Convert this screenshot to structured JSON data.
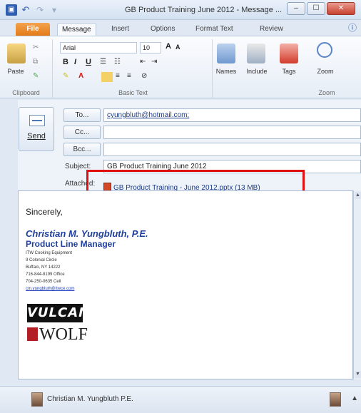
{
  "window": {
    "title": "GB Product Training June 2012 - Message ...",
    "buttons": {
      "minimize": "–",
      "maximize": "☐",
      "close": "✕"
    }
  },
  "qat": {
    "save": "▣",
    "undo": "↶",
    "redo": "↷",
    "customize": "▾"
  },
  "tabs": [
    {
      "label": "File"
    },
    {
      "label": "Message"
    },
    {
      "label": "Insert"
    },
    {
      "label": "Options"
    },
    {
      "label": "Format Text"
    },
    {
      "label": "Review"
    }
  ],
  "ribbon": {
    "clipboard": {
      "paste": "Paste",
      "group": "Clipboard"
    },
    "basic_text": {
      "font": "Arial",
      "size": "10",
      "grow": "A",
      "shrink": "A",
      "bold": "B",
      "italic": "I",
      "underline": "U",
      "group": "Basic Text"
    },
    "names": "Names",
    "include": "Include",
    "tags": "Tags",
    "zoom": {
      "button": "Zoom",
      "group": "Zoom"
    }
  },
  "compose": {
    "send": "Send",
    "to_button": "To...",
    "cc_button": "Cc...",
    "bcc_button": "Bcc...",
    "to_value": "cyungbluth@hotmail.com;",
    "cc_value": "",
    "bcc_value": "",
    "subject_label": "Subject:",
    "subject_value": "GB Product Training June 2012",
    "attached_label": "Attached:",
    "attachment": "GB Product Training - June 2012.pptx (13 MB)"
  },
  "body": {
    "greeting": "Sincerely,",
    "signature": {
      "name": "Christian M. Yungbluth, P.E.",
      "title": "Product Line Manager",
      "lines": [
        "ITW Cooking Equipment",
        "9 Colonial Circle",
        "Buffalo, NY 14222",
        "716-844-8199 Office",
        "704-250-0635 Cell"
      ],
      "email": "cm.yungbluth@itwce.com",
      "logo_vulcan": "VULCAN",
      "logo_wolf": "WOLF"
    }
  },
  "people_pane": {
    "name": "Christian M. Yungbluth P.E.",
    "toggle": "▲"
  }
}
